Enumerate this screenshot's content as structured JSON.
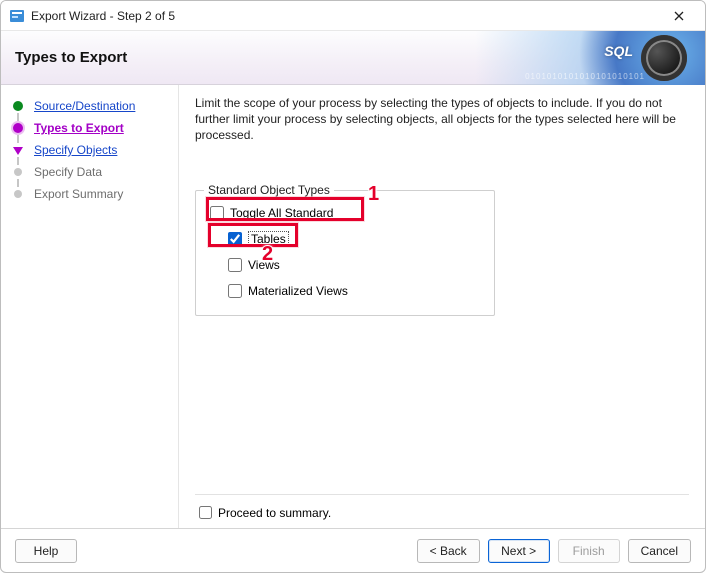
{
  "window": {
    "title": "Export Wizard - Step 2 of 5"
  },
  "banner": {
    "title": "Types to Export",
    "sql_text": "SQL",
    "bits": "0101010101010101010101"
  },
  "sidebar": {
    "steps": [
      {
        "label": "Source/Destination",
        "state": "done"
      },
      {
        "label": "Types to Export",
        "state": "current"
      },
      {
        "label": "Specify Objects",
        "state": "next"
      },
      {
        "label": "Specify Data",
        "state": "pending"
      },
      {
        "label": "Export Summary",
        "state": "pending"
      }
    ]
  },
  "main": {
    "instruction": "Limit the scope of your process by selecting the types of objects to include.  If you do not further limit your process by selecting objects, all objects for the types selected here will be processed.",
    "group_title": "Standard Object Types",
    "options": {
      "toggle_all": {
        "label": "Toggle All Standard",
        "checked": false
      },
      "tables": {
        "label": "Tables",
        "checked": true
      },
      "views": {
        "label": "Views",
        "checked": false
      },
      "matviews": {
        "label": "Materialized Views",
        "checked": false
      }
    },
    "proceed_label": "Proceed to summary.",
    "proceed_checked": false
  },
  "annotations": {
    "callout1": "1",
    "callout2": "2"
  },
  "footer": {
    "help": "Help",
    "back": "< Back",
    "next": "Next >",
    "finish": "Finish",
    "cancel": "Cancel"
  }
}
